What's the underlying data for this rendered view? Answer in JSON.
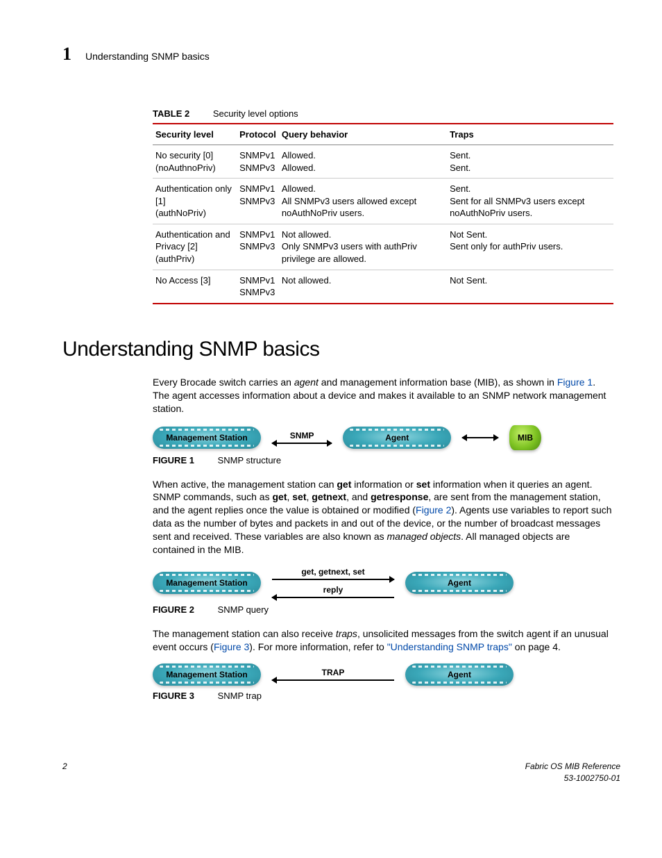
{
  "header": {
    "chapter_number": "1",
    "chapter_title": "Understanding SNMP basics"
  },
  "table2": {
    "caption_label": "TABLE 2",
    "caption_title": "Security level options",
    "headers": [
      "Security level",
      "Protocol",
      "Query behavior",
      "Traps"
    ],
    "rows": [
      {
        "level_l1": "No security [0]",
        "level_l2": "(noAuthnoPriv)",
        "proto_l1": "SNMPv1",
        "proto_l2": "SNMPv3",
        "query_l1": "Allowed.",
        "query_l2": "Allowed.",
        "traps_l1": "Sent.",
        "traps_l2": "Sent."
      },
      {
        "level_l1": "Authentication only [1]",
        "level_l2": "(authNoPriv)",
        "proto_l1": "SNMPv1",
        "proto_l2": "SNMPv3",
        "query_l1": "Allowed.",
        "query_l2": "All SNMPv3 users allowed except noAuthNoPriv users.",
        "traps_l1": "Sent.",
        "traps_l2": "Sent for all SNMPv3 users except noAuthNoPriv users."
      },
      {
        "level_l1": "Authentication and",
        "level_l2": "Privacy [2]",
        "level_l3": "(authPriv)",
        "proto_l1": "SNMPv1",
        "proto_l2": "SNMPv3",
        "query_l1": "Not allowed.",
        "query_l2": "Only SNMPv3 users with authPriv privilege are allowed.",
        "traps_l1": "Not Sent.",
        "traps_l2": "Sent only for authPriv users."
      },
      {
        "level_l1": "No Access [3]",
        "proto_l1": "SNMPv1",
        "proto_l2": "SNMPv3",
        "query_l1": "Not allowed.",
        "traps_l1": "Not Sent."
      }
    ]
  },
  "section_heading": "Understanding SNMP basics",
  "para1": {
    "pre": "Every Brocade switch carries an ",
    "agent": "agent",
    "mid": " and management information base (MIB), as shown in ",
    "fig1": "Figure 1",
    "post": ". The agent accesses information about a device and makes it available to an SNMP network management station."
  },
  "fig1": {
    "mgmt": "Management Station",
    "snmp": "SNMP",
    "agent": "Agent",
    "mib": "MIB",
    "caption_label": "FIGURE 1",
    "caption_title": "SNMP structure"
  },
  "para2": {
    "a": "When active, the management station can ",
    "get": "get",
    "b": " information or ",
    "set": "set",
    "c": " information when it queries an agent. SNMP commands, such as ",
    "get2": "get",
    "d": ", ",
    "set2": "set",
    "e": ", ",
    "getnext": "getnext",
    "f": ", and ",
    "getresponse": "getresponse",
    "g": ", are sent from the management station, and the agent replies once the value is obtained or modified (",
    "fig2": "Figure 2",
    "h": "). Agents use variables to report such data as the number of bytes and packets in and out of the device, or the number of broadcast messages sent and received. These variables are also known as ",
    "managed": "managed objects",
    "i": ". All managed objects are contained in the MIB."
  },
  "fig2": {
    "mgmt": "Management Station",
    "top": "get, getnext, set",
    "bottom": "reply",
    "agent": "Agent",
    "caption_label": "FIGURE 2",
    "caption_title": "SNMP query"
  },
  "para3": {
    "a": "The management station can also receive ",
    "traps": "traps",
    "b": ", unsolicited messages from the switch agent if an unusual event occurs (",
    "fig3": "Figure 3",
    "c": "). For more information, refer to ",
    "link": "\"Understanding SNMP traps\"",
    "d": " on page 4."
  },
  "fig3": {
    "mgmt": "Management Station",
    "trap": "TRAP",
    "agent": "Agent",
    "caption_label": "FIGURE 3",
    "caption_title": "SNMP trap"
  },
  "footer": {
    "page": "2",
    "doc": "Fabric OS MIB Reference",
    "docnum": "53-1002750-01"
  }
}
